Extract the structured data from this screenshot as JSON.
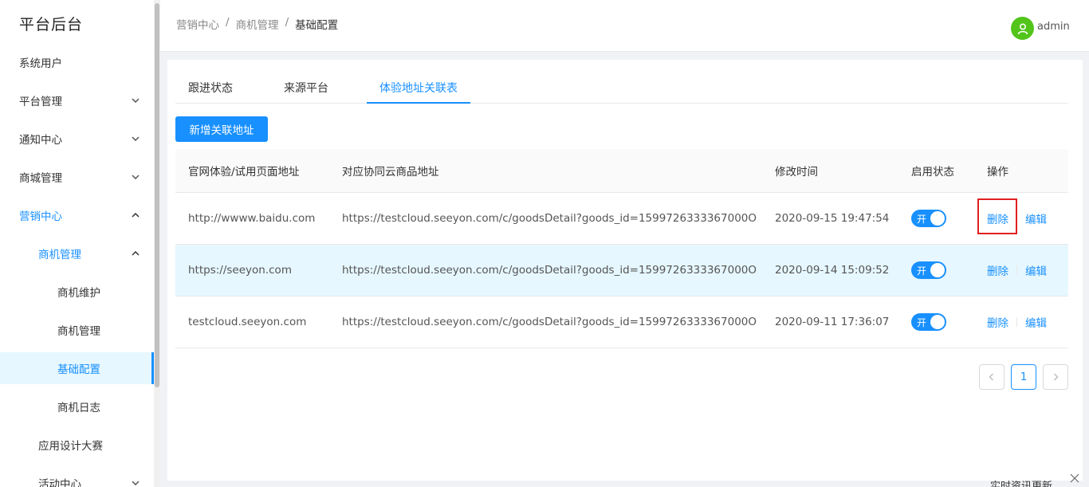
{
  "sidebar": {
    "logo": "平台后台",
    "items": [
      {
        "label": "系统用户"
      },
      {
        "label": "平台管理"
      },
      {
        "label": "通知中心"
      },
      {
        "label": "商城管理"
      },
      {
        "label": "营销中心"
      },
      {
        "label": "商机管理"
      },
      {
        "label": "商机维护"
      },
      {
        "label": "商机管理"
      },
      {
        "label": "基础配置"
      },
      {
        "label": "商机日志"
      },
      {
        "label": "应用设计大赛"
      },
      {
        "label": "活动中心"
      }
    ]
  },
  "header": {
    "breadcrumb": [
      "营销中心",
      "/",
      "商机管理",
      "/",
      "基础配置"
    ],
    "username": "admin"
  },
  "tabs": [
    {
      "label": "跟进状态"
    },
    {
      "label": "来源平台"
    },
    {
      "label": "体验地址关联表"
    }
  ],
  "add_button": "新增关联地址",
  "table": {
    "columns": [
      "官网体验/试用页面地址",
      "对应协同云商品地址",
      "修改时间",
      "启用状态",
      "操作"
    ],
    "rows": [
      {
        "page_url": "http://wwww.baidu.com",
        "goods_url": "https://testcloud.seeyon.com/c/goodsDetail?goods_id=1599726333367000O",
        "modified": "2020-09-15 19:47:54",
        "status": "开",
        "delete": "删除",
        "edit": "编辑"
      },
      {
        "page_url": "https://seeyon.com",
        "goods_url": "https://testcloud.seeyon.com/c/goodsDetail?goods_id=1599726333367000O",
        "modified": "2020-09-14 15:09:52",
        "status": "开",
        "delete": "删除",
        "edit": "编辑"
      },
      {
        "page_url": "testcloud.seeyon.com",
        "goods_url": "https://testcloud.seeyon.com/c/goodsDetail?goods_id=1599726333367000O",
        "modified": "2020-09-11 17:36:07",
        "status": "开",
        "delete": "删除",
        "edit": "编辑"
      }
    ]
  },
  "pagination": {
    "current": "1"
  },
  "news_popup": {
    "text": "实时资讯更新"
  },
  "colors": {
    "primary": "#1890ff",
    "avatar": "#52c41a",
    "highlight": "#e02020"
  }
}
